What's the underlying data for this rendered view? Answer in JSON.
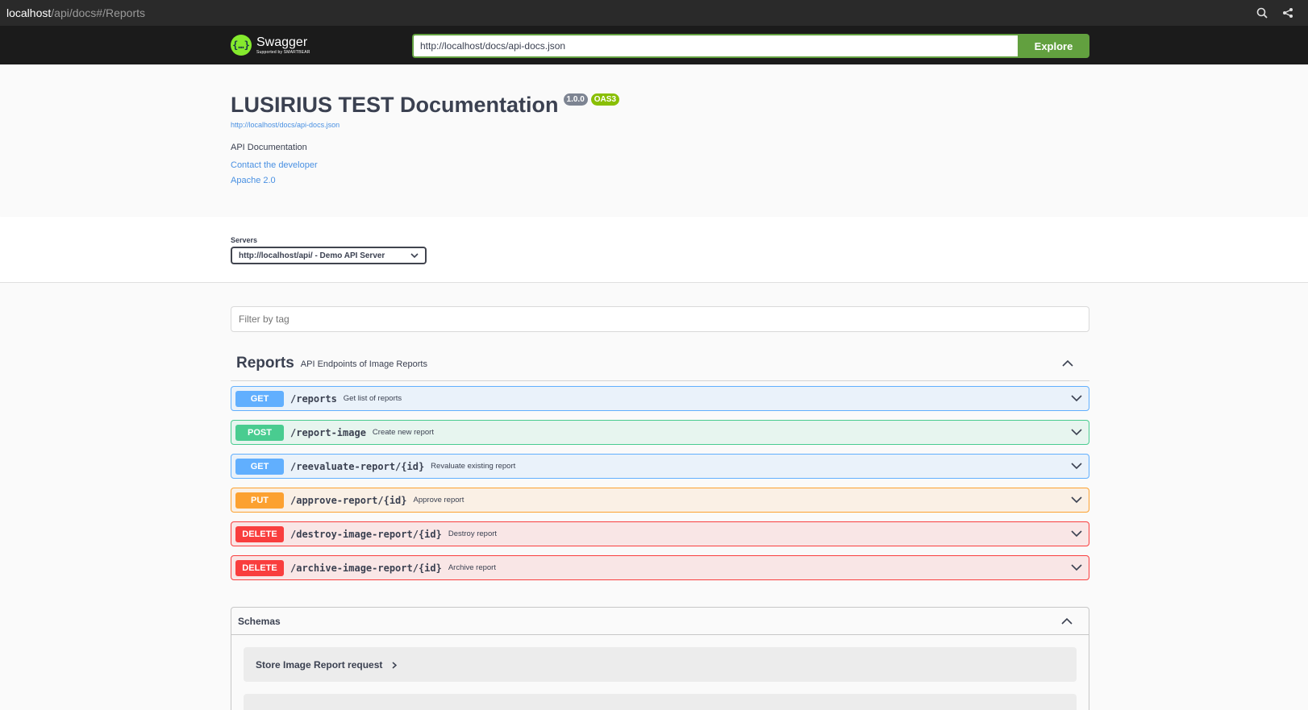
{
  "browser": {
    "url_host": "localhost",
    "url_path": "/api/docs#/Reports"
  },
  "topbar": {
    "logo_name": "Swagger",
    "logo_sub": "Supported by SMARTBEAR",
    "explore_url": "http://localhost/docs/api-docs.json",
    "explore_label": "Explore"
  },
  "info": {
    "title": "LUSIRIUS TEST Documentation",
    "version": "1.0.0",
    "oas": "OAS3",
    "spec_url": "http://localhost/docs/api-docs.json",
    "description": "API Documentation",
    "contact": "Contact the developer",
    "license": "Apache 2.0"
  },
  "servers": {
    "label": "Servers",
    "selected": "http://localhost/api/ - Demo API Server"
  },
  "filter": {
    "placeholder": "Filter by tag"
  },
  "tag": {
    "name": "Reports",
    "description": "API Endpoints of Image Reports"
  },
  "operations": [
    {
      "method": "GET",
      "path": "/reports",
      "summary": "Get list of reports"
    },
    {
      "method": "POST",
      "path": "/report-image",
      "summary": "Create new report"
    },
    {
      "method": "GET",
      "path": "/reevaluate-report/{id}",
      "summary": "Revaluate existing report"
    },
    {
      "method": "PUT",
      "path": "/approve-report/{id}",
      "summary": "Approve report"
    },
    {
      "method": "DELETE",
      "path": "/destroy-image-report/{id}",
      "summary": "Destroy report"
    },
    {
      "method": "DELETE",
      "path": "/archive-image-report/{id}",
      "summary": "Archive report"
    }
  ],
  "schemas": {
    "title": "Schemas",
    "models": [
      "Store Image Report request"
    ]
  },
  "colors": {
    "get": "#61affe",
    "post": "#49cc90",
    "put": "#fca130",
    "delete": "#f93e3e",
    "explore": "#62a03f",
    "link": "#4990e2"
  }
}
